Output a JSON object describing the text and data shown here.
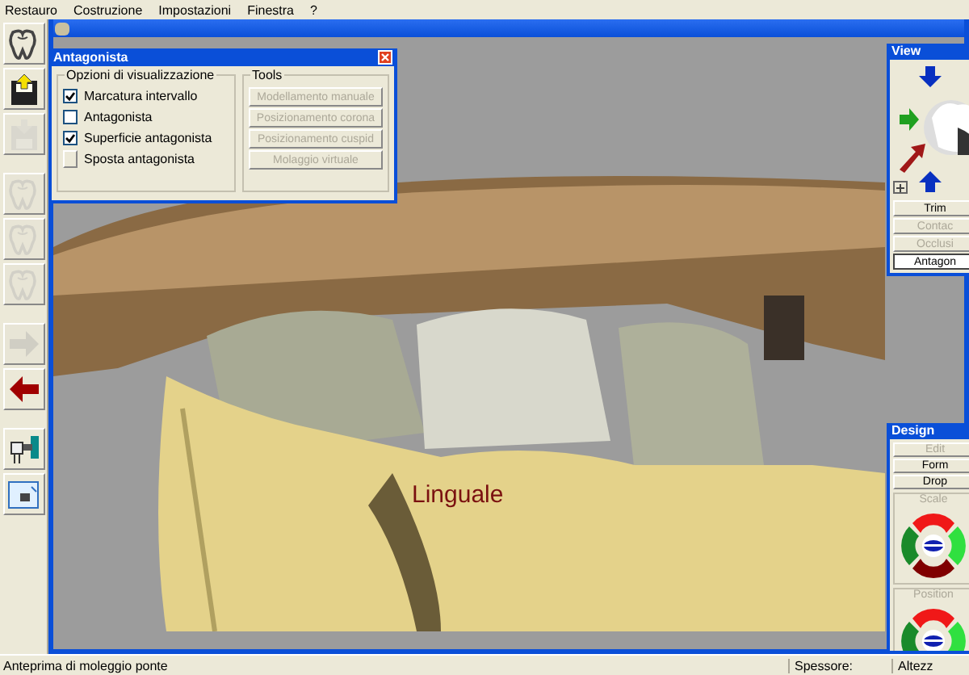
{
  "menu": [
    {
      "label": "Restauro"
    },
    {
      "label": "Costruzione"
    },
    {
      "label": "Impostazioni"
    },
    {
      "label": "Finestra"
    },
    {
      "label": "?"
    }
  ],
  "toolbar": [
    {
      "kind": "tooth",
      "disabled": false
    },
    {
      "kind": "save-up",
      "disabled": false
    },
    {
      "kind": "save-down",
      "disabled": true
    },
    {
      "kind": "tooth",
      "disabled": true
    },
    {
      "kind": "tooth",
      "disabled": true
    },
    {
      "kind": "tooth",
      "disabled": true
    },
    {
      "kind": "arrow-right",
      "disabled": true
    },
    {
      "kind": "arrow-left",
      "disabled": false
    },
    {
      "kind": "tool",
      "disabled": false
    },
    {
      "kind": "window",
      "disabled": false
    }
  ],
  "viewport": {
    "label": "Linguale"
  },
  "antagonist_dialog": {
    "title": "Antagonista",
    "options_group": "Opzioni di visualizzazione",
    "options": [
      {
        "kind": "checkbox",
        "label": "Marcatura intervallo",
        "checked": true
      },
      {
        "kind": "checkbox",
        "label": "Antagonista",
        "checked": false
      },
      {
        "kind": "checkbox",
        "label": "Superficie antagonista",
        "checked": true
      },
      {
        "kind": "spinner",
        "label": "Sposta antagonista"
      }
    ],
    "tools_group": "Tools",
    "tools": [
      {
        "label": "Modellamento manuale",
        "disabled": true
      },
      {
        "label": "Posizionamento corona",
        "disabled": true
      },
      {
        "label": "Posizionamento cuspid",
        "disabled": true
      },
      {
        "label": "Molaggio virtuale",
        "disabled": true
      }
    ]
  },
  "view_panel": {
    "title": "View",
    "buttons": [
      {
        "label": "Trim",
        "disabled": false,
        "selected": false
      },
      {
        "label": "Contac",
        "disabled": true,
        "selected": false
      },
      {
        "label": "Occlusi",
        "disabled": true,
        "selected": false
      },
      {
        "label": "Antagon",
        "disabled": false,
        "selected": true
      }
    ]
  },
  "design_panel": {
    "title": "Design",
    "buttons": [
      {
        "label": "Edit",
        "disabled": true
      },
      {
        "label": "Form",
        "disabled": false
      },
      {
        "label": "Drop",
        "disabled": false
      }
    ],
    "sections": [
      {
        "label": "Scale",
        "disabled": true
      },
      {
        "label": "Position",
        "disabled": true
      }
    ]
  },
  "status_bar": {
    "message": "Anteprima di moleggio ponte",
    "fields": [
      "Spessore:",
      "Altezz"
    ]
  }
}
